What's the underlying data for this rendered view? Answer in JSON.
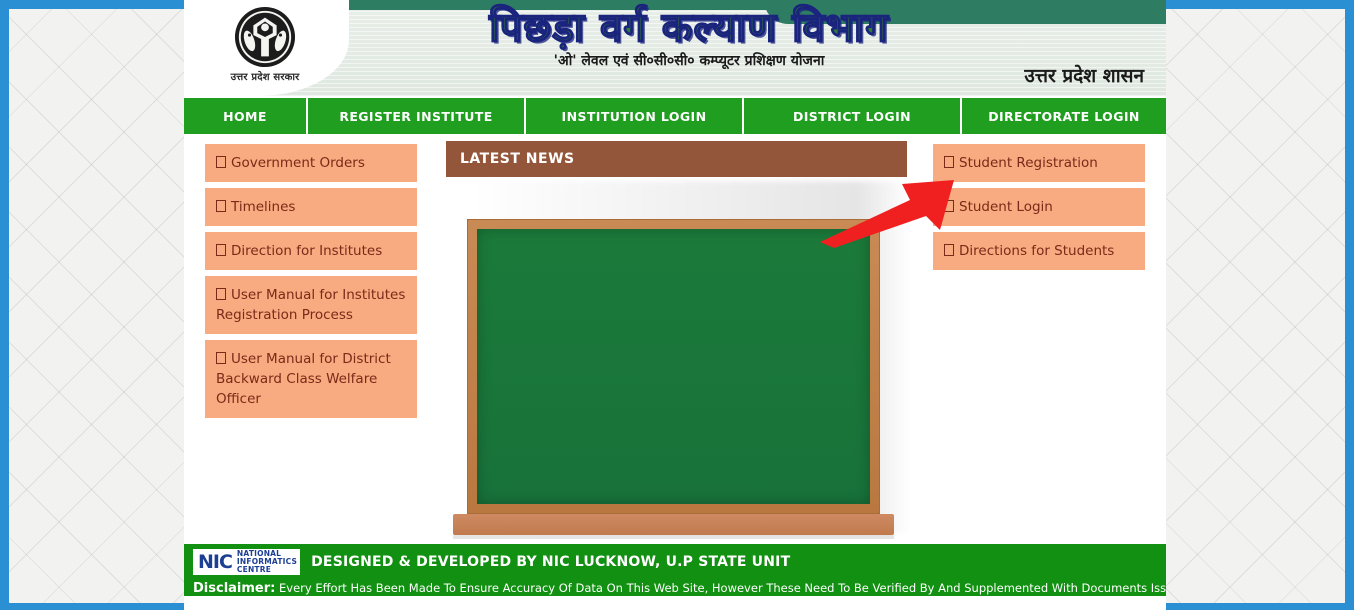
{
  "banner": {
    "emblem_caption": "उत्तर प्रदेश सरकार",
    "title_hindi": "पिछड़ा वर्ग कल्याण विभाग",
    "title_sub": "'ओ' लेवल एवं सी०सी०सी० कम्प्यूटर प्रशिक्षण योजना",
    "govt_label": "उत्तर प्रदेश शासन",
    "emblem_icon": "uttar-pradesh-state-emblem"
  },
  "nav": {
    "items": [
      {
        "label": "HOME"
      },
      {
        "label": "REGISTER INSTITUTE"
      },
      {
        "label": "INSTITUTION LOGIN"
      },
      {
        "label": "DISTRICT LOGIN"
      },
      {
        "label": "DIRECTORATE LOGIN"
      }
    ]
  },
  "left_menu": {
    "items": [
      {
        "label": "Government Orders"
      },
      {
        "label": "Timelines"
      },
      {
        "label": "Direction for Institutes"
      },
      {
        "label": "User Manual for Institutes Registration Process"
      },
      {
        "label": "User Manual for District Backward Class Welfare Officer"
      }
    ]
  },
  "news": {
    "title": "LATEST NEWS",
    "board_content": ""
  },
  "right_menu": {
    "items": [
      {
        "label": "Student Registration"
      },
      {
        "label": "Student Login"
      },
      {
        "label": "Directions for Students"
      }
    ]
  },
  "annotation": {
    "arrow_icon": "red-arrow-pointing-up-right",
    "arrow_color": "#f02020",
    "points_to": "Student Login"
  },
  "footer": {
    "nic_mark": "NIC",
    "nic_line1": "NATIONAL",
    "nic_line2": "INFORMATICS",
    "nic_line3": "CENTRE",
    "credit": "DESIGNED & DEVELOPED BY NIC LUCKNOW, U.P STATE UNIT",
    "disclaimer_label": "Disclaimer:",
    "disclaimer_text": "Every Effort Has Been Made To Ensure Accuracy Of Data On This Web Site, However These Need To Be Verified By And Supplemented With Documents Issued"
  },
  "colors": {
    "nav_green": "#1f9e1f",
    "tile_peach": "#f8ab80",
    "tile_text": "#7a2a18",
    "news_header_brown": "#93563a",
    "chalkboard_green": "#1d7a3c",
    "footer_green": "#119011",
    "frame_blue": "#2b8fd4",
    "banner_teal": "#2e7d63"
  }
}
